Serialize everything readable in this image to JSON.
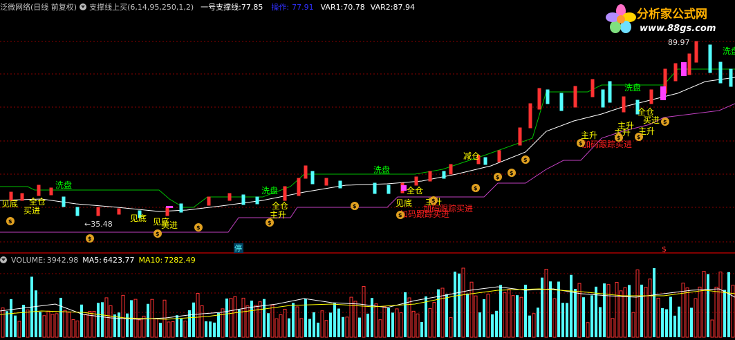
{
  "header": {
    "stock": "泛微网络(日线 前复权)",
    "indicator": "支撑线上买(6,14,95,250,1,2)",
    "line1_label": "一号支撑线:",
    "line1_value": "77.85",
    "op_label": "操作:",
    "op_value": "77.91",
    "var1_label": "VAR1:",
    "var1_value": "70.78",
    "var2_label": "VAR2:",
    "var2_value": "87.94"
  },
  "logo": {
    "text": "分析家公式网",
    "url": "www.88gs.com"
  },
  "price_labels": {
    "high": "89.97",
    "low": "←35.48"
  },
  "annotations": {
    "wash": "洗盘",
    "cangwei": "全仓",
    "buy": "买进",
    "bottom": "见底",
    "rise": "主升",
    "reduce": "减仓",
    "follow_buy": "加码跟踪买进",
    "stop": "停",
    "dollar": "$"
  },
  "volume": {
    "label": "VOLUME:",
    "value": "3942.98",
    "ma5_label": "MA5:",
    "ma5_value": "6423.77",
    "ma10_label": "MA10:",
    "ma10_value": "7282.49"
  },
  "colors": {
    "up": "#ff3232",
    "down": "#54ffff",
    "white_line": "#ffffff",
    "support": "#c040c0",
    "wash_line": "#00c000",
    "header_label": "#ffffff",
    "op_color": "#3030ff",
    "yellow": "#ffff00"
  }
}
